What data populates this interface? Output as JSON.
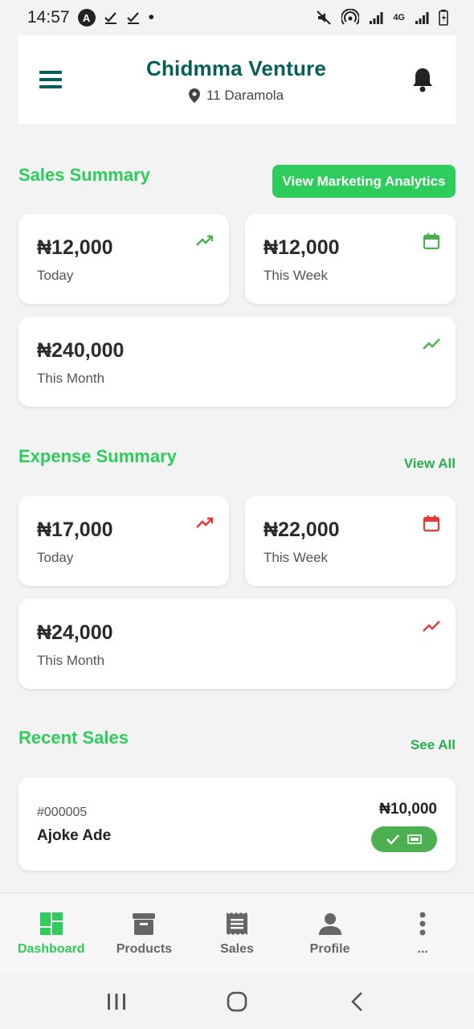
{
  "status_bar": {
    "time": "14:57",
    "a_glyph": "A",
    "dot": "•",
    "network": "4G"
  },
  "header": {
    "title": "Chidmma Venture",
    "location": "11 Daramola"
  },
  "sales_summary": {
    "title": "Sales Summary",
    "action_label": "View Marketing Analytics",
    "cards": [
      {
        "amount": "₦12,000",
        "label": "Today",
        "icon": "trending-up-icon"
      },
      {
        "amount": "₦12,000",
        "label": "This Week",
        "icon": "calendar-icon"
      },
      {
        "amount": "₦240,000",
        "label": "This Month",
        "icon": "trend-line-icon"
      }
    ]
  },
  "expense_summary": {
    "title": "Expense Summary",
    "action_label": "View All",
    "cards": [
      {
        "amount": "₦17,000",
        "label": "Today",
        "icon": "trending-up-icon"
      },
      {
        "amount": "₦22,000",
        "label": "This Week",
        "icon": "calendar-icon"
      },
      {
        "amount": "₦24,000",
        "label": "This Month",
        "icon": "trend-line-icon"
      }
    ]
  },
  "recent_sales": {
    "title": "Recent Sales",
    "action_label": "See All",
    "items": [
      {
        "id": "#000005",
        "customer": "Ajoke Ade",
        "amount": "₦10,000",
        "status_icons": [
          "check-icon",
          "cash-icon"
        ]
      }
    ]
  },
  "bottom_nav": {
    "items": [
      {
        "label": "Dashboard",
        "icon": "dashboard-icon",
        "active": true
      },
      {
        "label": "Products",
        "icon": "archive-box-icon",
        "active": false
      },
      {
        "label": "Sales",
        "icon": "receipt-icon",
        "active": false
      },
      {
        "label": "Profile",
        "icon": "person-icon",
        "active": false
      },
      {
        "label": "...",
        "icon": "more-vertical-icon",
        "active": false
      }
    ]
  },
  "colors": {
    "brand_dark": "#075e54",
    "accent_green": "#2ecc5a",
    "sales_icon": "#4caf50",
    "expense_icon": "#e53935",
    "background": "#f3f3f3"
  }
}
